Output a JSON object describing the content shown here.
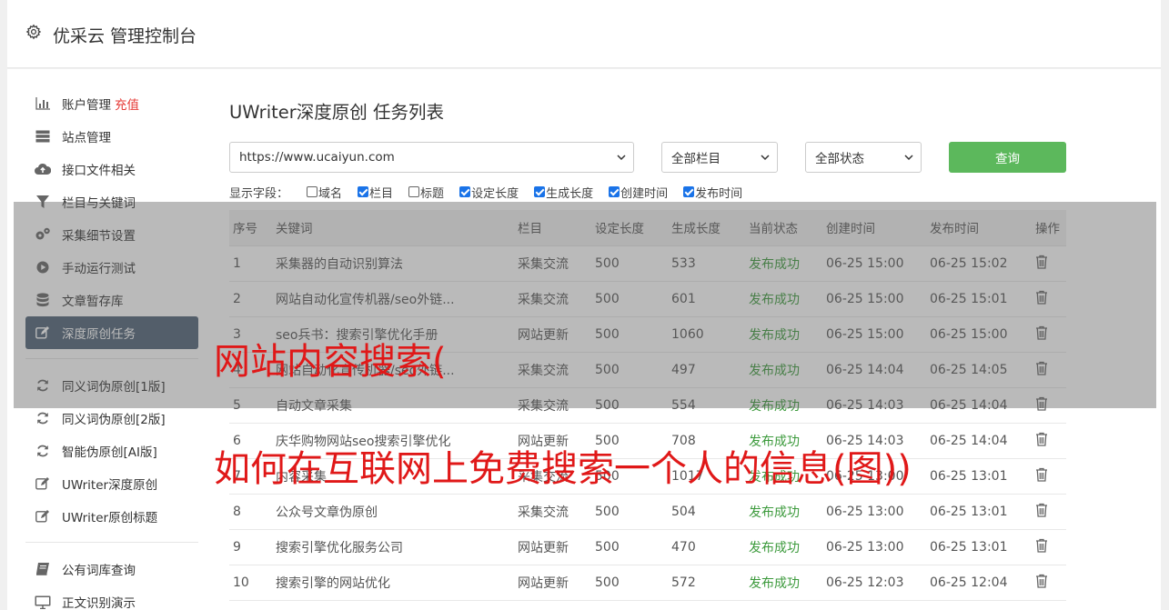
{
  "header": {
    "title": "优采云 管理控制台",
    "icon": "gear-icon"
  },
  "sidebar": {
    "groups": [
      [
        {
          "label": "账户管理",
          "badge": "充值",
          "icon": "bar-chart-icon"
        },
        {
          "label": "站点管理",
          "icon": "server-icon"
        },
        {
          "label": "接口文件相关",
          "icon": "cloud-upload-icon"
        },
        {
          "label": "栏目与关键词",
          "icon": "filter-icon"
        },
        {
          "label": "采集细节设置",
          "icon": "gears-icon"
        },
        {
          "label": "手动运行测试",
          "icon": "play-icon"
        },
        {
          "label": "文章暂存库",
          "icon": "database-icon"
        },
        {
          "label": "深度原创任务",
          "icon": "edit-icon",
          "active": true
        }
      ],
      [
        {
          "label": "同义词伪原创[1版]",
          "icon": "refresh-icon"
        },
        {
          "label": "同义词伪原创[2版]",
          "icon": "refresh-icon"
        },
        {
          "label": "智能伪原创[AI版]",
          "icon": "refresh-icon"
        },
        {
          "label": "UWriter深度原创",
          "icon": "edit-icon"
        },
        {
          "label": "UWriter原创标题",
          "icon": "edit-icon"
        }
      ],
      [
        {
          "label": "公有词库查询",
          "icon": "book-icon"
        },
        {
          "label": "正文识别演示",
          "icon": "monitor-icon"
        }
      ]
    ]
  },
  "main": {
    "title": "UWriter深度原创 任务列表",
    "site_select": "https://www.ucaiyun.com",
    "column_select": "全部栏目",
    "status_select": "全部状态",
    "query_label": "查询",
    "fields_label": "显示字段：",
    "fields": [
      {
        "label": "域名",
        "checked": false
      },
      {
        "label": "栏目",
        "checked": true
      },
      {
        "label": "标题",
        "checked": false
      },
      {
        "label": "设定长度",
        "checked": true
      },
      {
        "label": "生成长度",
        "checked": true
      },
      {
        "label": "创建时间",
        "checked": true
      },
      {
        "label": "发布时间",
        "checked": true
      }
    ],
    "table": {
      "headers": [
        "序号",
        "关键词",
        "栏目",
        "设定长度",
        "生成长度",
        "当前状态",
        "创建时间",
        "发布时间",
        "操作"
      ],
      "rows": [
        [
          "1",
          "采集器的自动识别算法",
          "采集交流",
          "500",
          "533",
          "发布成功",
          "06-25 15:00",
          "06-25 15:02"
        ],
        [
          "2",
          "网站自动化宣传机器/seo外链...",
          "采集交流",
          "500",
          "601",
          "发布成功",
          "06-25 15:00",
          "06-25 15:01"
        ],
        [
          "3",
          "seo兵书：搜索引擎优化手册",
          "网站更新",
          "500",
          "1060",
          "发布成功",
          "06-25 15:00",
          "06-25 15:00"
        ],
        [
          "4",
          "网站自动化宣传机器/seo外链...",
          "采集交流",
          "500",
          "497",
          "发布成功",
          "06-25 14:04",
          "06-25 14:05"
        ],
        [
          "5",
          "自动文章采集",
          "采集交流",
          "500",
          "554",
          "发布成功",
          "06-25 14:03",
          "06-25 14:04"
        ],
        [
          "6",
          "庆华购物网站seo搜索引擎优化",
          "网站更新",
          "500",
          "708",
          "发布成功",
          "06-25 14:03",
          "06-25 14:04"
        ],
        [
          "7",
          "内容采集",
          "采集交流",
          "500",
          "1017",
          "发布成功",
          "06-25 13:00",
          "06-25 13:01"
        ],
        [
          "8",
          "公众号文章伪原创",
          "采集交流",
          "500",
          "504",
          "发布成功",
          "06-25 13:00",
          "06-25 13:01"
        ],
        [
          "9",
          "搜索引擎优化服务公司",
          "网站更新",
          "500",
          "470",
          "发布成功",
          "06-25 13:00",
          "06-25 13:01"
        ],
        [
          "10",
          "搜索引擎的网站优化",
          "网站更新",
          "500",
          "572",
          "发布成功",
          "06-25 12:03",
          "06-25 12:04"
        ]
      ]
    }
  },
  "watermark": {
    "line1": "网站内容搜索(",
    "line2": "如何在互联网上免费搜索一个人的信息(图))"
  },
  "colors": {
    "accent_green": "#5cb85c",
    "active_nav": "#4e6175",
    "charge_red": "#e53935",
    "status_green": "#3c9a3c",
    "watermark_red": "#e01818"
  }
}
